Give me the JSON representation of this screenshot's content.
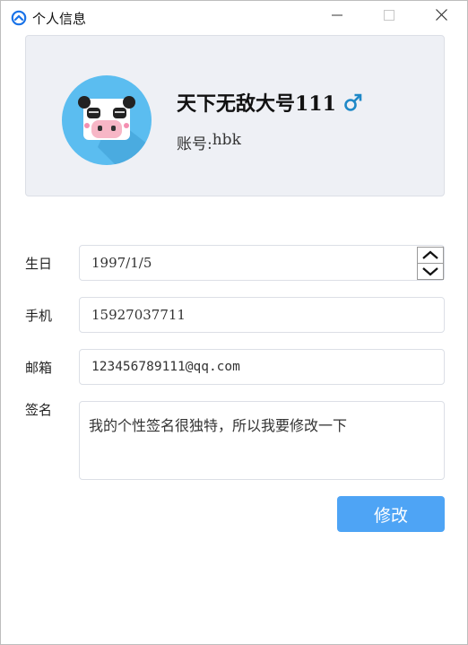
{
  "window": {
    "title": "个人信息",
    "accent": "#4ea4f5"
  },
  "profile": {
    "nickname": "天下无敌大号111",
    "gender_icon": "male-icon",
    "gender_color": "#1e88c7",
    "account_label": "账号:",
    "account_value": "hbk"
  },
  "form": {
    "birthday": {
      "label": "生日",
      "value": "1997/1/5"
    },
    "phone": {
      "label": "手机",
      "value": "15927037711"
    },
    "email": {
      "label": "邮箱",
      "value": "123456789111@qq.com"
    },
    "signature": {
      "label": "签名",
      "value": "我的个性签名很独特，所以我要修改一下"
    },
    "submit_label": "修改"
  }
}
